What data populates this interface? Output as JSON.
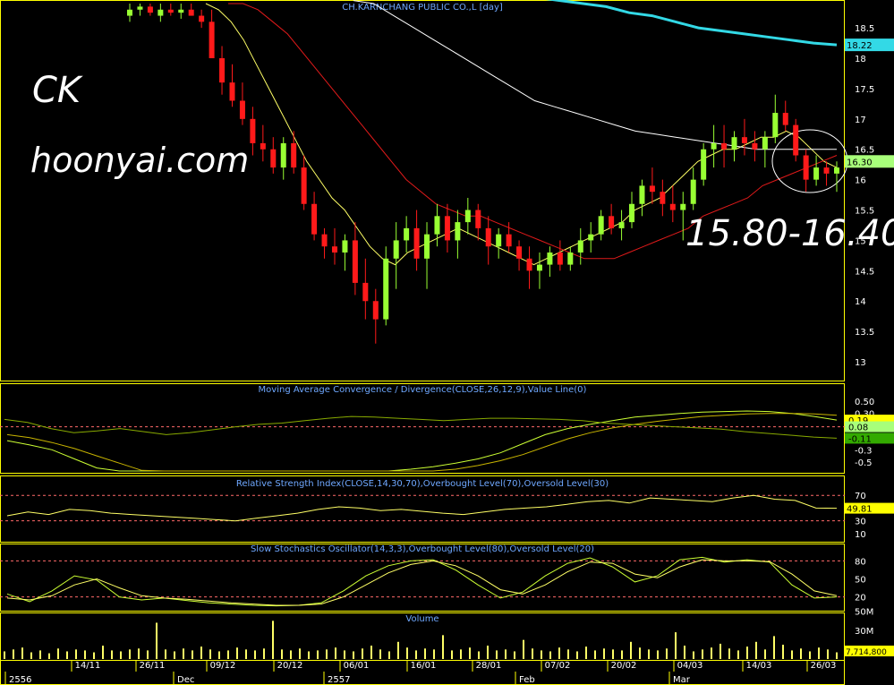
{
  "overlay": {
    "ticker": "CK",
    "site": "hoonyai.com",
    "range": "15.80-16.40"
  },
  "colors": {
    "background": "#000000",
    "frame": "#ffff00",
    "grid": "#5a5a00",
    "up_candle": "#99ff33",
    "down_candle": "#ff1a1a",
    "ma_fast": "#ffff66",
    "ma_mid": "#e01a1a",
    "ma_slow": "#ffffff",
    "ma_long": "#33d9e6",
    "panel_title": "#6fa8ff",
    "macd_line": "#ccff33",
    "signal_line": "#c8b400",
    "level_line": "#ff6a6a",
    "badge_green": "#a8ff7a",
    "badge_yellow": "#ffff00"
  },
  "chart_data": [
    {
      "type": "candlestick",
      "title": "CH.KARNCHANG PUBLIC CO.,L [day]",
      "ylim": [
        12.75,
        18.9
      ],
      "y_ticks": [
        "18.5",
        "18",
        "17.5",
        "17",
        "16.5",
        "16",
        "15.5",
        "15",
        "14.5",
        "14",
        "13.5",
        "13"
      ],
      "last_price_label": "16.30",
      "long_ma_label": "18.22",
      "ohlc": [
        [
          18.7,
          18.9,
          18.6,
          18.8
        ],
        [
          18.8,
          18.9,
          18.7,
          18.85
        ],
        [
          18.85,
          18.9,
          18.7,
          18.75
        ],
        [
          18.7,
          18.9,
          18.6,
          18.8
        ],
        [
          18.8,
          18.9,
          18.7,
          18.75
        ],
        [
          18.75,
          18.9,
          18.65,
          18.8
        ],
        [
          18.8,
          18.9,
          18.7,
          18.7
        ],
        [
          18.7,
          18.8,
          18.5,
          18.6
        ],
        [
          18.6,
          18.8,
          18.4,
          18.0
        ],
        [
          18.0,
          18.2,
          17.4,
          17.6
        ],
        [
          17.6,
          17.9,
          17.2,
          17.3
        ],
        [
          17.3,
          17.6,
          16.9,
          17.0
        ],
        [
          17.0,
          17.2,
          16.4,
          16.6
        ],
        [
          16.6,
          16.9,
          16.3,
          16.5
        ],
        [
          16.5,
          16.7,
          16.1,
          16.2
        ],
        [
          16.2,
          16.7,
          16.0,
          16.6
        ],
        [
          16.6,
          16.8,
          16.1,
          16.2
        ],
        [
          16.2,
          16.4,
          15.5,
          15.6
        ],
        [
          15.6,
          15.8,
          15.0,
          15.1
        ],
        [
          15.1,
          15.2,
          14.7,
          14.9
        ],
        [
          14.9,
          15.2,
          14.6,
          14.8
        ],
        [
          14.8,
          15.1,
          14.5,
          15.0
        ],
        [
          15.0,
          15.3,
          14.1,
          14.3
        ],
        [
          14.3,
          14.7,
          13.7,
          14.0
        ],
        [
          14.0,
          14.2,
          13.3,
          13.7
        ],
        [
          13.7,
          14.9,
          13.6,
          14.7
        ],
        [
          14.7,
          15.3,
          14.2,
          15.0
        ],
        [
          15.0,
          15.4,
          14.8,
          15.2
        ],
        [
          15.2,
          15.5,
          14.5,
          14.7
        ],
        [
          14.7,
          15.3,
          14.2,
          15.1
        ],
        [
          15.1,
          15.6,
          14.9,
          15.4
        ],
        [
          15.4,
          15.6,
          14.8,
          15.0
        ],
        [
          15.0,
          15.5,
          14.7,
          15.3
        ],
        [
          15.3,
          15.7,
          15.1,
          15.5
        ],
        [
          15.5,
          15.6,
          15.0,
          15.2
        ],
        [
          15.2,
          15.4,
          14.6,
          14.9
        ],
        [
          14.9,
          15.2,
          14.7,
          15.1
        ],
        [
          15.1,
          15.3,
          14.8,
          14.9
        ],
        [
          14.9,
          15.0,
          14.5,
          14.7
        ],
        [
          14.7,
          14.9,
          14.2,
          14.5
        ],
        [
          14.5,
          14.8,
          14.2,
          14.6
        ],
        [
          14.6,
          14.9,
          14.4,
          14.8
        ],
        [
          14.8,
          15.0,
          14.5,
          14.6
        ],
        [
          14.6,
          14.9,
          14.5,
          14.8
        ],
        [
          14.8,
          15.2,
          14.6,
          15.0
        ],
        [
          15.0,
          15.3,
          14.8,
          15.1
        ],
        [
          15.1,
          15.5,
          15.0,
          15.4
        ],
        [
          15.4,
          15.6,
          15.1,
          15.2
        ],
        [
          15.2,
          15.5,
          15.0,
          15.3
        ],
        [
          15.3,
          15.8,
          15.2,
          15.6
        ],
        [
          15.6,
          16.0,
          15.4,
          15.9
        ],
        [
          15.9,
          16.2,
          15.6,
          15.8
        ],
        [
          15.8,
          16.0,
          15.4,
          15.6
        ],
        [
          15.6,
          15.9,
          15.3,
          15.5
        ],
        [
          15.5,
          15.8,
          15.0,
          15.6
        ],
        [
          15.6,
          16.2,
          15.5,
          16.0
        ],
        [
          16.0,
          16.6,
          15.9,
          16.5
        ],
        [
          16.5,
          16.9,
          16.2,
          16.6
        ],
        [
          16.6,
          16.9,
          16.2,
          16.5
        ],
        [
          16.5,
          16.8,
          16.3,
          16.7
        ],
        [
          16.7,
          17.0,
          16.4,
          16.6
        ],
        [
          16.6,
          16.8,
          16.3,
          16.5
        ],
        [
          16.5,
          16.8,
          16.2,
          16.7
        ],
        [
          16.7,
          17.4,
          16.6,
          17.1
        ],
        [
          17.1,
          17.3,
          16.8,
          16.9
        ],
        [
          16.9,
          17.0,
          16.3,
          16.4
        ],
        [
          16.4,
          16.5,
          15.8,
          16.0
        ],
        [
          16.0,
          16.4,
          15.9,
          16.2
        ],
        [
          16.2,
          16.3,
          15.9,
          16.1
        ],
        [
          16.1,
          16.3,
          15.8,
          16.2
        ]
      ],
      "overlay_lines": [
        {
          "name": "ma_fast",
          "values": [
            18.9,
            18.8,
            18.6,
            18.3,
            17.9,
            17.5,
            17.1,
            16.7,
            16.3,
            16.0,
            15.7,
            15.5,
            15.2,
            14.9,
            14.7,
            14.6,
            14.8,
            14.9,
            15.0,
            15.1,
            15.2,
            15.1,
            15.0,
            14.9,
            14.8,
            14.7,
            14.6,
            14.7,
            14.8,
            14.9,
            15.0,
            15.1,
            15.2,
            15.3,
            15.5,
            15.6,
            15.7,
            15.9,
            16.1,
            16.3,
            16.4,
            16.5,
            16.5,
            16.6,
            16.7,
            16.7,
            16.8,
            16.7,
            16.5,
            16.3,
            16.2
          ]
        },
        {
          "name": "ma_mid",
          "values": [
            18.9,
            18.9,
            18.8,
            18.6,
            18.4,
            18.1,
            17.8,
            17.5,
            17.2,
            16.9,
            16.6,
            16.3,
            16.0,
            15.8,
            15.6,
            15.5,
            15.4,
            15.4,
            15.3,
            15.2,
            15.1,
            15.0,
            14.9,
            14.8,
            14.7,
            14.7,
            14.7,
            14.8,
            14.9,
            15.0,
            15.1,
            15.2,
            15.4,
            15.5,
            15.6,
            15.7,
            15.9,
            16.0,
            16.1,
            16.2,
            16.3,
            16.4
          ]
        },
        {
          "name": "ma_slow",
          "values": [
            18.95,
            18.9,
            18.7,
            18.5,
            18.3,
            18.1,
            17.9,
            17.7,
            17.5,
            17.3,
            17.2,
            17.1,
            17.0,
            16.9,
            16.8,
            16.75,
            16.7,
            16.65,
            16.6,
            16.55,
            16.5,
            16.5,
            16.5,
            16.5,
            16.5
          ]
        },
        {
          "name": "ma_long",
          "values": [
            19.0,
            18.95,
            18.9,
            18.85,
            18.75,
            18.7,
            18.6,
            18.5,
            18.45,
            18.4,
            18.35,
            18.3,
            18.25,
            18.22
          ]
        }
      ],
      "x_ticks": [
        "14/11",
        "26/11",
        "09/12",
        "20/12",
        "06/01",
        "16/01",
        "28/01",
        "07/02",
        "20/02",
        "04/03",
        "14/03",
        "26/03"
      ],
      "period_labels": [
        "2556",
        "Dec",
        "2557",
        "Feb",
        "Mar"
      ]
    },
    {
      "type": "line",
      "title": "Moving Average Convergence / Divergence(CLOSE,26,12,9),Value Line(0)",
      "ylim": [
        -0.65,
        0.62
      ],
      "y_ticks": [
        "0.50",
        "0.30",
        "0.08",
        "-0.3",
        "-0.5"
      ],
      "value_labels": [
        "0.19",
        "0.08",
        "-0.11"
      ],
      "series": [
        {
          "name": "MACD",
          "values": [
            -0.15,
            -0.22,
            -0.3,
            -0.45,
            -0.6,
            -0.7,
            -0.8,
            -0.9,
            -0.95,
            -0.98,
            -1.0,
            -0.97,
            -0.9,
            -0.85,
            -0.8,
            -0.75,
            -0.7,
            -0.65,
            -0.62,
            -0.58,
            -0.52,
            -0.45,
            -0.35,
            -0.2,
            -0.05,
            0.05,
            0.12,
            0.18,
            0.24,
            0.27,
            0.3,
            0.32,
            0.33,
            0.34,
            0.33,
            0.3,
            0.25,
            0.19
          ]
        },
        {
          "name": "Signal",
          "values": [
            -0.05,
            -0.1,
            -0.18,
            -0.28,
            -0.4,
            -0.52,
            -0.64,
            -0.74,
            -0.82,
            -0.88,
            -0.93,
            -0.95,
            -0.94,
            -0.91,
            -0.88,
            -0.84,
            -0.79,
            -0.74,
            -0.7,
            -0.66,
            -0.62,
            -0.56,
            -0.48,
            -0.38,
            -0.25,
            -0.12,
            -0.02,
            0.06,
            0.12,
            0.17,
            0.21,
            0.25,
            0.27,
            0.29,
            0.3,
            0.3,
            0.29,
            0.27
          ]
        },
        {
          "name": "Histogram",
          "values": [
            0.2,
            0.15,
            0.05,
            -0.02,
            0.01,
            0.05,
            0.0,
            -0.05,
            -0.02,
            0.03,
            0.08,
            0.12,
            0.14,
            0.18,
            0.22,
            0.25,
            0.24,
            0.22,
            0.2,
            0.18,
            0.2,
            0.22,
            0.22,
            0.21,
            0.2,
            0.18,
            0.14,
            0.12,
            0.1,
            0.08,
            0.06,
            0.04,
            0.0,
            -0.03,
            -0.06,
            -0.09,
            -0.11
          ]
        }
      ]
    },
    {
      "type": "line",
      "title": "Relative Strength Index(CLOSE,14,30,70),Overbought Level(70),Oversold Level(30)",
      "ylim": [
        0,
        90
      ],
      "y_ticks": [
        "70",
        "50",
        "30",
        "10"
      ],
      "value_labels": [
        "49.81"
      ],
      "series": [
        {
          "name": "RSI",
          "values": [
            38,
            44,
            40,
            48,
            46,
            42,
            40,
            38,
            36,
            34,
            32,
            30,
            34,
            38,
            42,
            48,
            52,
            50,
            46,
            48,
            45,
            42,
            40,
            44,
            48,
            50,
            52,
            56,
            60,
            62,
            58,
            66,
            64,
            62,
            60,
            66,
            70,
            64,
            62,
            50,
            49.81
          ]
        }
      ]
    },
    {
      "type": "line",
      "title": "Slow Stochastics Oscillator(14,3,3),Overbought Level(80),Oversold Level(20)",
      "ylim": [
        0,
        100
      ],
      "y_ticks": [
        "80",
        "50",
        "20"
      ],
      "series": [
        {
          "name": "%K",
          "values": [
            25,
            12,
            30,
            55,
            48,
            20,
            15,
            18,
            14,
            10,
            8,
            6,
            5,
            6,
            10,
            30,
            55,
            72,
            80,
            82,
            65,
            40,
            18,
            28,
            55,
            76,
            85,
            70,
            45,
            55,
            82,
            86,
            78,
            82,
            78,
            40,
            18,
            20
          ]
        },
        {
          "name": "%D",
          "values": [
            18,
            15,
            22,
            40,
            50,
            35,
            22,
            18,
            16,
            13,
            10,
            8,
            6,
            6,
            8,
            20,
            40,
            60,
            74,
            80,
            72,
            55,
            32,
            25,
            40,
            62,
            78,
            76,
            58,
            52,
            70,
            82,
            80,
            80,
            79,
            58,
            30,
            22
          ]
        }
      ]
    },
    {
      "type": "bar",
      "title": "Volume",
      "y_ticks": [
        "50M",
        "30M",
        "10M"
      ],
      "value_labels": [
        "7,714,800"
      ],
      "values": [
        8,
        10,
        12,
        7,
        9,
        6,
        11,
        8,
        10,
        9,
        7,
        14,
        9,
        8,
        10,
        11,
        9,
        38,
        10,
        8,
        11,
        9,
        13,
        10,
        8,
        9,
        12,
        10,
        9,
        11,
        40,
        10,
        9,
        11,
        8,
        9,
        10,
        12,
        9,
        8,
        11,
        14,
        10,
        8,
        18,
        12,
        9,
        11,
        10,
        25,
        9,
        10,
        12,
        8,
        14,
        9,
        10,
        8,
        20,
        11,
        9,
        8,
        12,
        10,
        8,
        13,
        9,
        11,
        10,
        9,
        18,
        12,
        10,
        9,
        11,
        28,
        14,
        8,
        10,
        12,
        16,
        11,
        9,
        13,
        18,
        10,
        24,
        15,
        9,
        11,
        8,
        12,
        10,
        7
      ]
    }
  ]
}
